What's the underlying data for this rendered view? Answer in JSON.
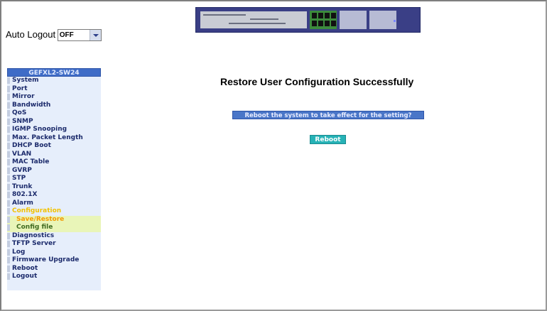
{
  "auto_logout": {
    "label": "Auto Logout",
    "value": "OFF"
  },
  "menu": {
    "header": "GEFXL2-SW24",
    "items": [
      "System",
      "Port",
      "Mirror",
      "Bandwidth",
      "QoS",
      "SNMP",
      "IGMP Snooping",
      "Max. Packet Length",
      "DHCP Boot",
      "VLAN",
      "MAC Table",
      "GVRP",
      "STP",
      "Trunk",
      "802.1X",
      "Alarm",
      "Configuration"
    ],
    "sub_items": [
      "Save/Restore",
      "Config file"
    ],
    "items_after": [
      "Diagnostics",
      "TFTP Server",
      "Log",
      "Firmware Upgrade",
      "Reboot",
      "Logout"
    ]
  },
  "main": {
    "title": "Restore User Configuration Successfully",
    "prompt": "Reboot the system to take effect for the setting?",
    "reboot_button": "Reboot"
  },
  "colors": {
    "menu_header": "#3f6cc7",
    "menu_background": "#e6eefb",
    "menu_text": "#1b2a6b",
    "selected_section": "#f2c200",
    "selected_sub": "#f29a00",
    "button": "#26b2b6"
  }
}
